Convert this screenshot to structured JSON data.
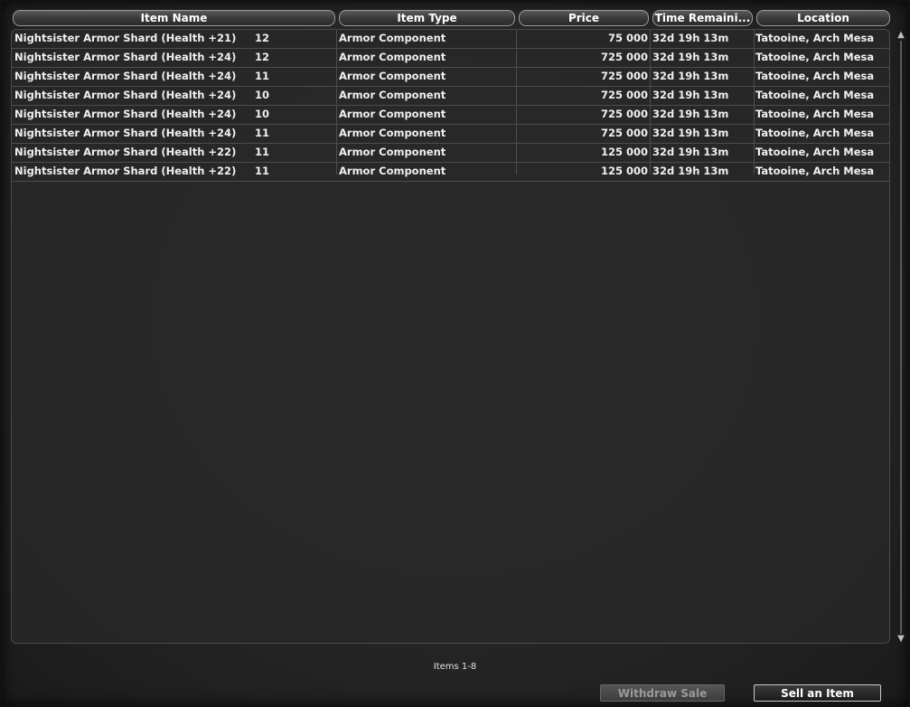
{
  "columns": {
    "item_name": "Item Name",
    "item_type": "Item Type",
    "price": "Price",
    "time_remaining": "Time Remaini...",
    "location": "Location"
  },
  "rows": [
    {
      "name": "Nightsister Armor Shard (Health +21)",
      "qty": "12",
      "type": "Armor Component",
      "price": "75 000",
      "time": "32d 19h 13m",
      "location": "Tatooine, Arch Mesa"
    },
    {
      "name": "Nightsister Armor Shard (Health +24)",
      "qty": "12",
      "type": "Armor Component",
      "price": "725 000",
      "time": "32d 19h 13m",
      "location": "Tatooine, Arch Mesa"
    },
    {
      "name": "Nightsister Armor Shard (Health +24)",
      "qty": "11",
      "type": "Armor Component",
      "price": "725 000",
      "time": "32d 19h 13m",
      "location": "Tatooine, Arch Mesa"
    },
    {
      "name": "Nightsister Armor Shard (Health +24)",
      "qty": "10",
      "type": "Armor Component",
      "price": "725 000",
      "time": "32d 19h 13m",
      "location": "Tatooine, Arch Mesa"
    },
    {
      "name": "Nightsister Armor Shard (Health +24)",
      "qty": "10",
      "type": "Armor Component",
      "price": "725 000",
      "time": "32d 19h 13m",
      "location": "Tatooine, Arch Mesa"
    },
    {
      "name": "Nightsister Armor Shard (Health +24)",
      "qty": "11",
      "type": "Armor Component",
      "price": "725 000",
      "time": "32d 19h 13m",
      "location": "Tatooine, Arch Mesa"
    },
    {
      "name": "Nightsister Armor Shard (Health +22)",
      "qty": "11",
      "type": "Armor Component",
      "price": "125 000",
      "time": "32d 19h 13m",
      "location": "Tatooine, Arch Mesa"
    },
    {
      "name": "Nightsister Armor Shard (Health +22)",
      "qty": "11",
      "type": "Armor Component",
      "price": "125 000",
      "time": "32d 19h 13m",
      "location": "Tatooine, Arch Mesa"
    }
  ],
  "footer": {
    "items_count": "Items 1-8",
    "withdraw_label": "Withdraw Sale",
    "sell_label": "Sell an Item"
  },
  "icons": {
    "scroll_up": "arrow-up-icon",
    "scroll_down": "arrow-down-icon"
  }
}
